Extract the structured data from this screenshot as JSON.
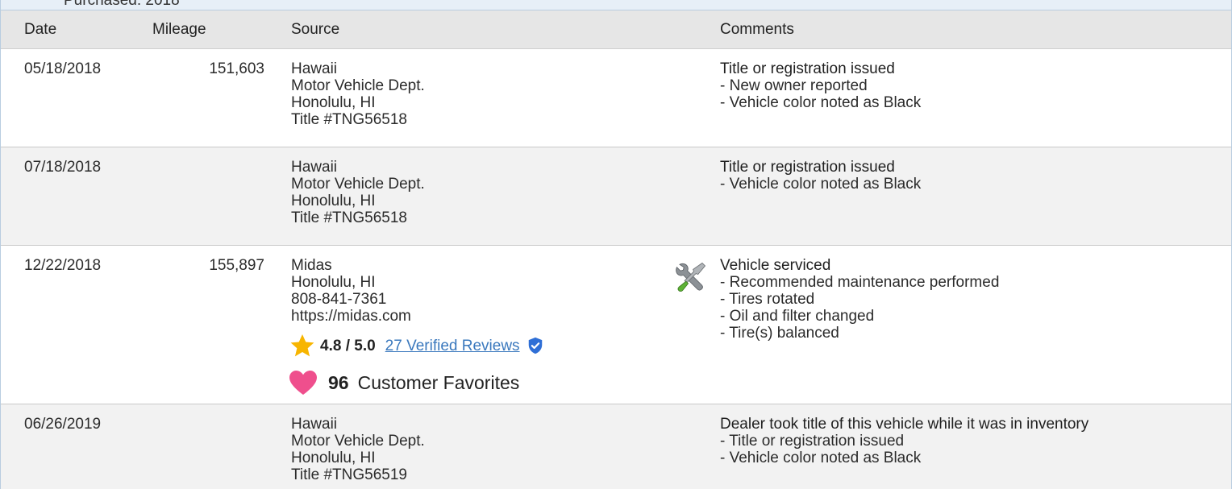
{
  "owner_strip": {
    "text": "Purchased: 2018"
  },
  "table": {
    "headers": {
      "date": "Date",
      "mileage": "Mileage",
      "source": "Source",
      "comments": "Comments"
    },
    "rows": [
      {
        "date": "05/18/2018",
        "mileage": "151,603",
        "source": [
          "Hawaii",
          "Motor Vehicle Dept.",
          "Honolulu, HI",
          "Title #TNG56518"
        ],
        "comment_title": "Title or registration issued",
        "comment_items": [
          "- New owner reported",
          "- Vehicle color noted as Black"
        ]
      },
      {
        "date": "07/18/2018",
        "mileage": "",
        "source": [
          "Hawaii",
          "Motor Vehicle Dept.",
          "Honolulu, HI",
          "Title #TNG56518"
        ],
        "comment_title": "Title or registration issued",
        "comment_items": [
          "- Vehicle color noted as Black"
        ]
      },
      {
        "date": "12/22/2018",
        "mileage": "155,897",
        "source": [
          "Midas",
          "Honolulu, HI",
          "808-841-7361",
          "https://midas.com"
        ],
        "rating": "4.8 / 5.0",
        "reviews_link": "27 Verified Reviews",
        "favorites_count": "96",
        "favorites_label": "Customer Favorites",
        "comment_title": "Vehicle serviced",
        "comment_items": [
          "- Recommended maintenance performed",
          "- Tires rotated",
          "- Oil and filter changed",
          "- Tire(s) balanced"
        ],
        "comment_icon": "wrench-screwdriver-icon"
      },
      {
        "date": "06/26/2019",
        "mileage": "",
        "source": [
          "Hawaii",
          "Motor Vehicle Dept.",
          "Honolulu, HI",
          "Title #TNG56519"
        ],
        "comment_title": "Dealer took title of this vehicle while it was in inventory",
        "comment_items": [
          "- Title or registration issued",
          "- Vehicle color noted as Black"
        ]
      }
    ]
  },
  "colors": {
    "header_bg": "#e6e6e6",
    "alt_row_bg": "#f2f2f2",
    "link": "#3a78bd",
    "star": "#f7b500",
    "heart": "#ef4f8d",
    "verified": "#2f6fd6"
  }
}
